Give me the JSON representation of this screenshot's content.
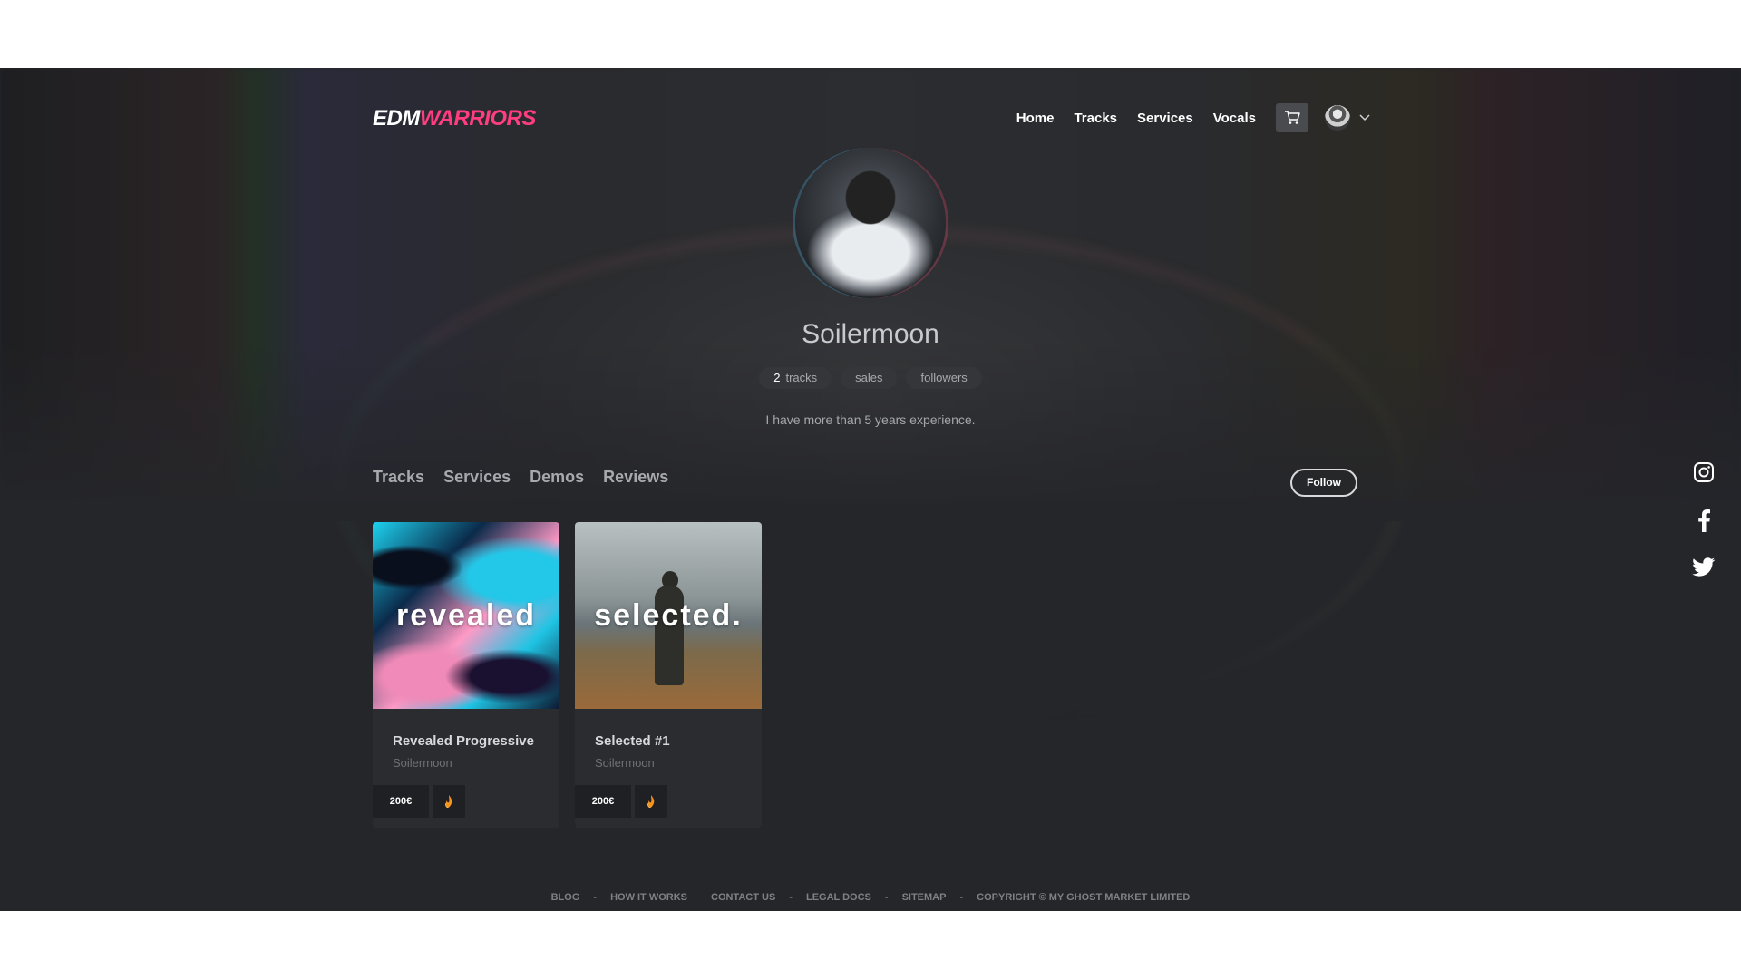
{
  "header": {
    "logo_part1": "EDM",
    "logo_part2": "WARRIORS",
    "nav": [
      "Home",
      "Tracks",
      "Services",
      "Vocals"
    ]
  },
  "profile": {
    "name": "Soilermoon",
    "badges": {
      "tracks_count": "2",
      "tracks_label": "tracks",
      "sales_label": "sales",
      "followers_label": "followers"
    },
    "bio": "I have more than 5 years experience."
  },
  "tabs": [
    "Tracks",
    "Services",
    "Demos",
    "Reviews"
  ],
  "follow_label": "Follow",
  "tracks": [
    {
      "cover_text": "revealed",
      "title": "Revealed Progressive",
      "artist": "Soilermoon",
      "price": "200€",
      "daw_icon": "fl-studio-icon"
    },
    {
      "cover_text": "selected.",
      "title": "Selected #1",
      "artist": "Soilermoon",
      "price": "200€",
      "daw_icon": "fl-studio-icon"
    }
  ],
  "social": [
    "instagram-icon",
    "facebook-icon",
    "twitter-icon"
  ],
  "footer": {
    "blog": "BLOG",
    "how_it_works": "HOW IT WORKS",
    "contact_us": "CONTACT US",
    "legal_docs": "LEGAL DOCS",
    "sitemap": "SITEMAP",
    "copyright": "COPYRIGHT © MY GHOST MARKET LIMITED",
    "separator": "-"
  },
  "colors": {
    "accent": "#ff3d7f",
    "background": "#25262a",
    "card": "#2b2c30"
  }
}
